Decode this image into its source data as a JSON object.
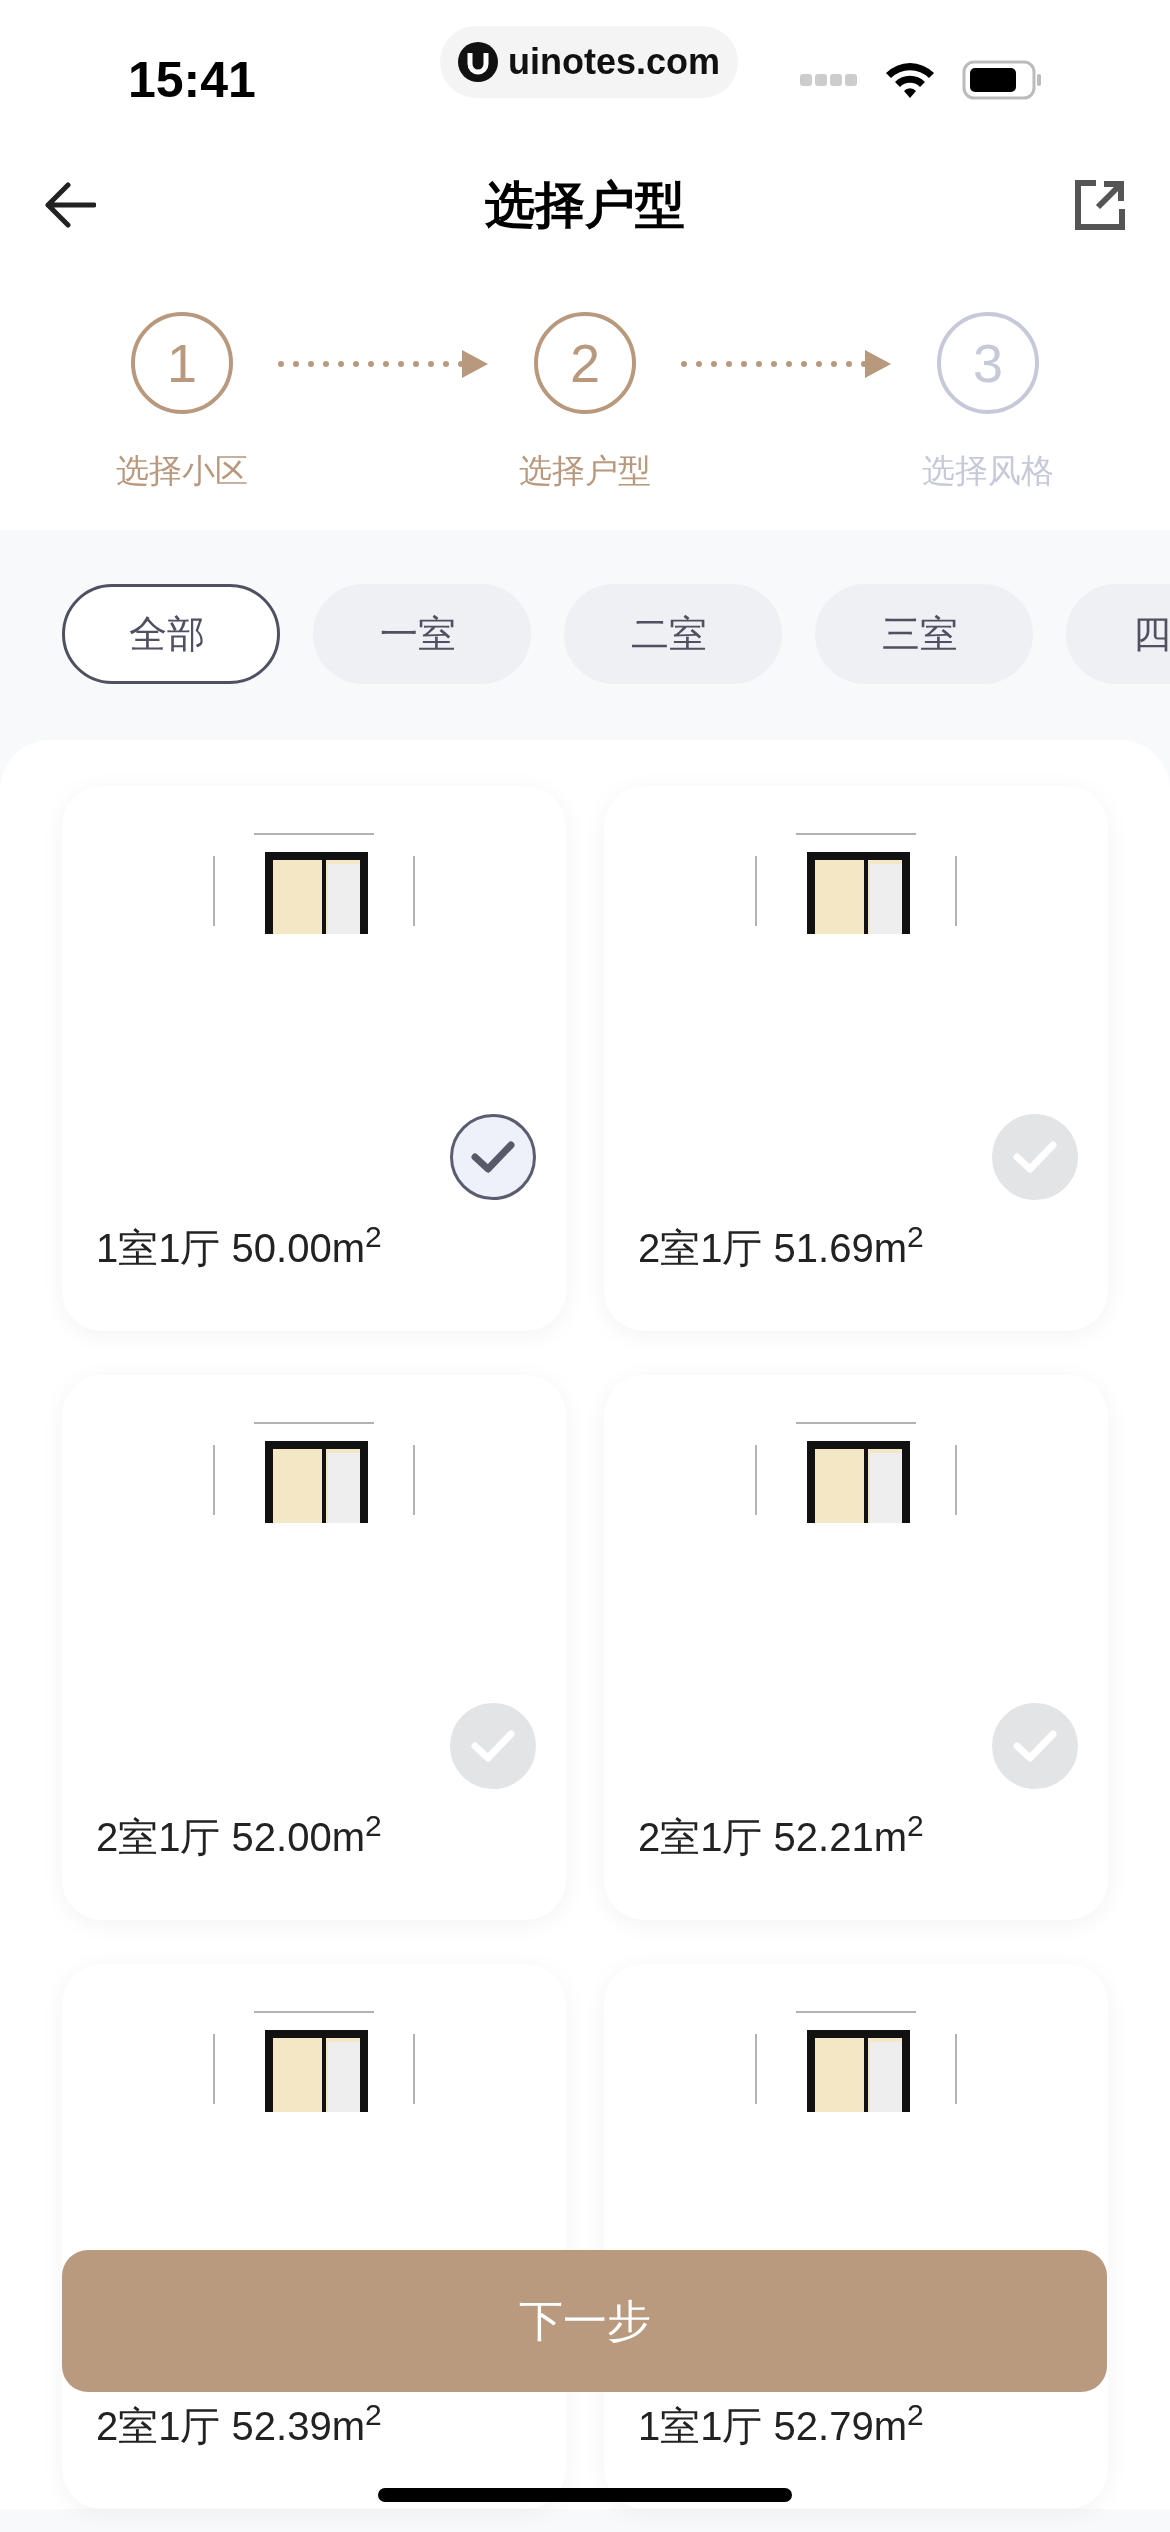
{
  "status_bar": {
    "time": "15:41",
    "url": "uinotes.com"
  },
  "header": {
    "title": "选择户型"
  },
  "steps": [
    {
      "number": "1",
      "label": "选择小区",
      "active": true
    },
    {
      "number": "2",
      "label": "选择户型",
      "active": true
    },
    {
      "number": "3",
      "label": "选择风格",
      "active": false
    }
  ],
  "filters": [
    {
      "label": "全部",
      "selected": true
    },
    {
      "label": "一室",
      "selected": false
    },
    {
      "label": "二室",
      "selected": false
    },
    {
      "label": "三室",
      "selected": false
    },
    {
      "label": "四",
      "selected": false
    }
  ],
  "layouts": [
    {
      "title": "1室1厅  50.00m$^{2}$",
      "selected": true
    },
    {
      "title": "2室1厅  51.69m$^{2}$",
      "selected": false
    },
    {
      "title": "2室1厅  52.00m$^{2}$",
      "selected": false
    },
    {
      "title": "2室1厅  52.21m$^{2}$",
      "selected": false
    },
    {
      "title": "2室1厅  52.39m$^{2}$"
    },
    {
      "title": "1室1厅  52.79m$^{2}$"
    }
  ],
  "next_button": "下一步"
}
